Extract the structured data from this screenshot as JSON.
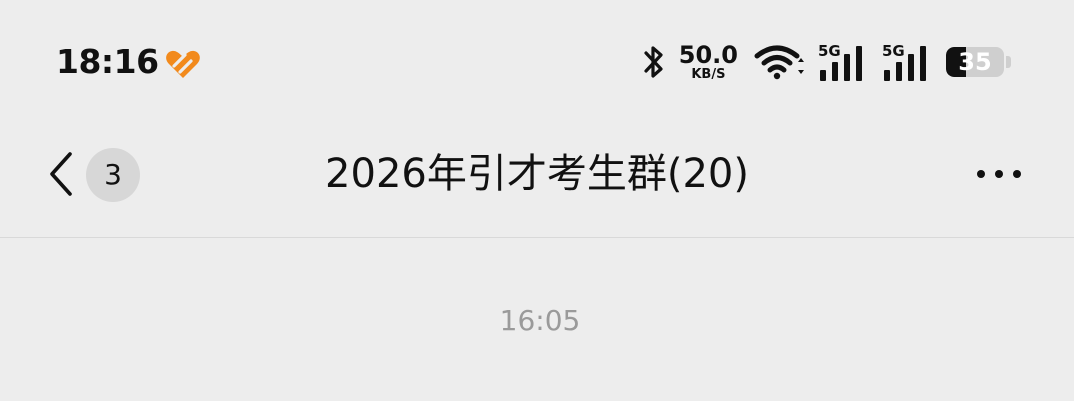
{
  "status_bar": {
    "time": "18:16",
    "app_icon": "orange-heart-icon",
    "bluetooth_icon": "bluetooth-icon",
    "network_speed": {
      "value": "50.0",
      "unit": "KB/S"
    },
    "wifi_icon": "wifi-icon",
    "signals": [
      {
        "label": "5G",
        "icon": "cellular-signal-icon"
      },
      {
        "label": "5G",
        "icon": "cellular-signal-icon"
      }
    ],
    "battery": {
      "level": 35,
      "text": "35"
    }
  },
  "header": {
    "back_icon": "chevron-left-icon",
    "unread_count": "3",
    "title": "2026年引才考生群(20)",
    "more_icon": "more-horizontal-icon"
  },
  "chat": {
    "timestamp": "16:05"
  },
  "colors": {
    "background": "#ededed",
    "accent": "#f28a1c",
    "badge": "#d7d7d7",
    "timestamp": "#9a9a9a"
  }
}
